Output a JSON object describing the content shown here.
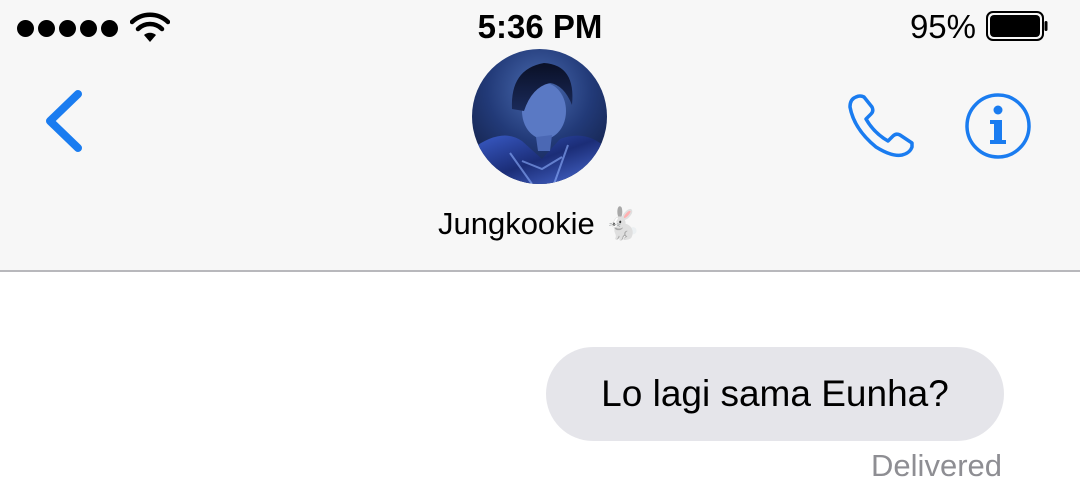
{
  "status_bar": {
    "signal_dots": 5,
    "wifi_icon": "wifi-icon",
    "time": "5:36 PM",
    "battery_percent": "95%",
    "battery_level": 0.95
  },
  "header": {
    "back_icon": "chevron-left-icon",
    "contact_name": "Jungkookie 🐇",
    "phone_icon": "phone-icon",
    "info_icon": "info-icon",
    "accent_color": "#1a7cf0"
  },
  "messages": [
    {
      "text": "Lo lagi sama Eunha?",
      "status": "Delivered"
    }
  ]
}
